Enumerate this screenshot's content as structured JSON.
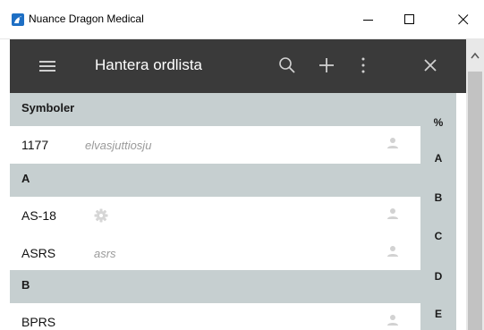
{
  "window": {
    "title": "Nuance Dragon Medical",
    "icon": "dragon-app-icon"
  },
  "header": {
    "menu_icon": "hamburger-menu-icon",
    "title": "Hantera ordlista",
    "search_icon": "search-icon",
    "add_icon": "plus-icon",
    "more_icon": "more-vertical-icon",
    "close_icon": "close-icon"
  },
  "sections": [
    {
      "label": "Symboler"
    },
    {
      "label": "A"
    },
    {
      "label": "B"
    }
  ],
  "rows": [
    {
      "term": "1177",
      "spoken": "elvasjuttiosju",
      "user_icon": "user-icon"
    },
    {
      "term": "AS-18",
      "spoken": "",
      "gear_icon": "gear-icon",
      "user_icon": "user-icon"
    },
    {
      "term": "ASRS",
      "spoken": "asrs",
      "user_icon": "user-icon"
    },
    {
      "term": "BPRS",
      "spoken": "",
      "user_icon": "user-icon"
    }
  ],
  "index": [
    "%",
    "A",
    "B",
    "C",
    "D",
    "E"
  ],
  "colors": {
    "header_bg": "#3a3a3a",
    "section_bg": "#c6cfd0",
    "spoken_text": "#9a9a9a"
  }
}
